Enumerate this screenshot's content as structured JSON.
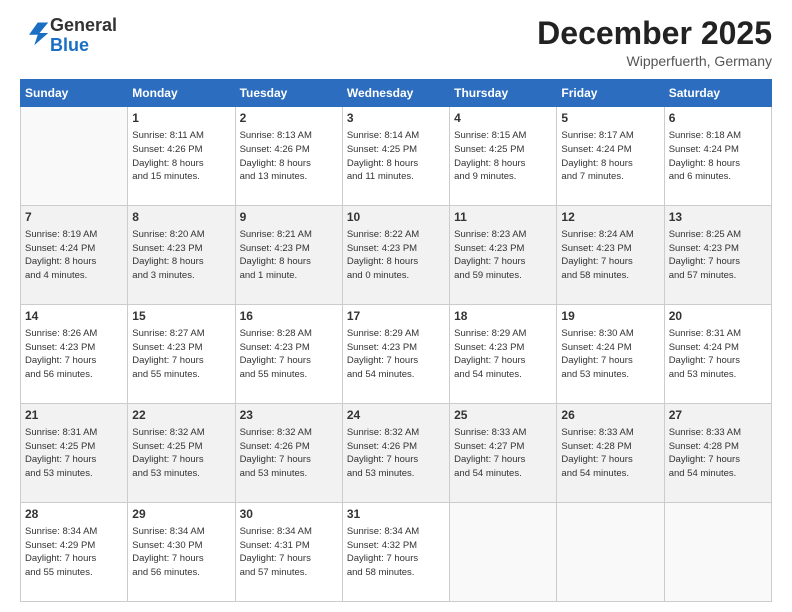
{
  "header": {
    "logo_general": "General",
    "logo_blue": "Blue",
    "month": "December 2025",
    "location": "Wipperfuerth, Germany"
  },
  "days_of_week": [
    "Sunday",
    "Monday",
    "Tuesday",
    "Wednesday",
    "Thursday",
    "Friday",
    "Saturday"
  ],
  "weeks": [
    [
      {
        "day": "",
        "info": ""
      },
      {
        "day": "1",
        "info": "Sunrise: 8:11 AM\nSunset: 4:26 PM\nDaylight: 8 hours\nand 15 minutes."
      },
      {
        "day": "2",
        "info": "Sunrise: 8:13 AM\nSunset: 4:26 PM\nDaylight: 8 hours\nand 13 minutes."
      },
      {
        "day": "3",
        "info": "Sunrise: 8:14 AM\nSunset: 4:25 PM\nDaylight: 8 hours\nand 11 minutes."
      },
      {
        "day": "4",
        "info": "Sunrise: 8:15 AM\nSunset: 4:25 PM\nDaylight: 8 hours\nand 9 minutes."
      },
      {
        "day": "5",
        "info": "Sunrise: 8:17 AM\nSunset: 4:24 PM\nDaylight: 8 hours\nand 7 minutes."
      },
      {
        "day": "6",
        "info": "Sunrise: 8:18 AM\nSunset: 4:24 PM\nDaylight: 8 hours\nand 6 minutes."
      }
    ],
    [
      {
        "day": "7",
        "info": "Sunrise: 8:19 AM\nSunset: 4:24 PM\nDaylight: 8 hours\nand 4 minutes."
      },
      {
        "day": "8",
        "info": "Sunrise: 8:20 AM\nSunset: 4:23 PM\nDaylight: 8 hours\nand 3 minutes."
      },
      {
        "day": "9",
        "info": "Sunrise: 8:21 AM\nSunset: 4:23 PM\nDaylight: 8 hours\nand 1 minute."
      },
      {
        "day": "10",
        "info": "Sunrise: 8:22 AM\nSunset: 4:23 PM\nDaylight: 8 hours\nand 0 minutes."
      },
      {
        "day": "11",
        "info": "Sunrise: 8:23 AM\nSunset: 4:23 PM\nDaylight: 7 hours\nand 59 minutes."
      },
      {
        "day": "12",
        "info": "Sunrise: 8:24 AM\nSunset: 4:23 PM\nDaylight: 7 hours\nand 58 minutes."
      },
      {
        "day": "13",
        "info": "Sunrise: 8:25 AM\nSunset: 4:23 PM\nDaylight: 7 hours\nand 57 minutes."
      }
    ],
    [
      {
        "day": "14",
        "info": "Sunrise: 8:26 AM\nSunset: 4:23 PM\nDaylight: 7 hours\nand 56 minutes."
      },
      {
        "day": "15",
        "info": "Sunrise: 8:27 AM\nSunset: 4:23 PM\nDaylight: 7 hours\nand 55 minutes."
      },
      {
        "day": "16",
        "info": "Sunrise: 8:28 AM\nSunset: 4:23 PM\nDaylight: 7 hours\nand 55 minutes."
      },
      {
        "day": "17",
        "info": "Sunrise: 8:29 AM\nSunset: 4:23 PM\nDaylight: 7 hours\nand 54 minutes."
      },
      {
        "day": "18",
        "info": "Sunrise: 8:29 AM\nSunset: 4:23 PM\nDaylight: 7 hours\nand 54 minutes."
      },
      {
        "day": "19",
        "info": "Sunrise: 8:30 AM\nSunset: 4:24 PM\nDaylight: 7 hours\nand 53 minutes."
      },
      {
        "day": "20",
        "info": "Sunrise: 8:31 AM\nSunset: 4:24 PM\nDaylight: 7 hours\nand 53 minutes."
      }
    ],
    [
      {
        "day": "21",
        "info": "Sunrise: 8:31 AM\nSunset: 4:25 PM\nDaylight: 7 hours\nand 53 minutes."
      },
      {
        "day": "22",
        "info": "Sunrise: 8:32 AM\nSunset: 4:25 PM\nDaylight: 7 hours\nand 53 minutes."
      },
      {
        "day": "23",
        "info": "Sunrise: 8:32 AM\nSunset: 4:26 PM\nDaylight: 7 hours\nand 53 minutes."
      },
      {
        "day": "24",
        "info": "Sunrise: 8:32 AM\nSunset: 4:26 PM\nDaylight: 7 hours\nand 53 minutes."
      },
      {
        "day": "25",
        "info": "Sunrise: 8:33 AM\nSunset: 4:27 PM\nDaylight: 7 hours\nand 54 minutes."
      },
      {
        "day": "26",
        "info": "Sunrise: 8:33 AM\nSunset: 4:28 PM\nDaylight: 7 hours\nand 54 minutes."
      },
      {
        "day": "27",
        "info": "Sunrise: 8:33 AM\nSunset: 4:28 PM\nDaylight: 7 hours\nand 54 minutes."
      }
    ],
    [
      {
        "day": "28",
        "info": "Sunrise: 8:34 AM\nSunset: 4:29 PM\nDaylight: 7 hours\nand 55 minutes."
      },
      {
        "day": "29",
        "info": "Sunrise: 8:34 AM\nSunset: 4:30 PM\nDaylight: 7 hours\nand 56 minutes."
      },
      {
        "day": "30",
        "info": "Sunrise: 8:34 AM\nSunset: 4:31 PM\nDaylight: 7 hours\nand 57 minutes."
      },
      {
        "day": "31",
        "info": "Sunrise: 8:34 AM\nSunset: 4:32 PM\nDaylight: 7 hours\nand 58 minutes."
      },
      {
        "day": "",
        "info": ""
      },
      {
        "day": "",
        "info": ""
      },
      {
        "day": "",
        "info": ""
      }
    ]
  ]
}
